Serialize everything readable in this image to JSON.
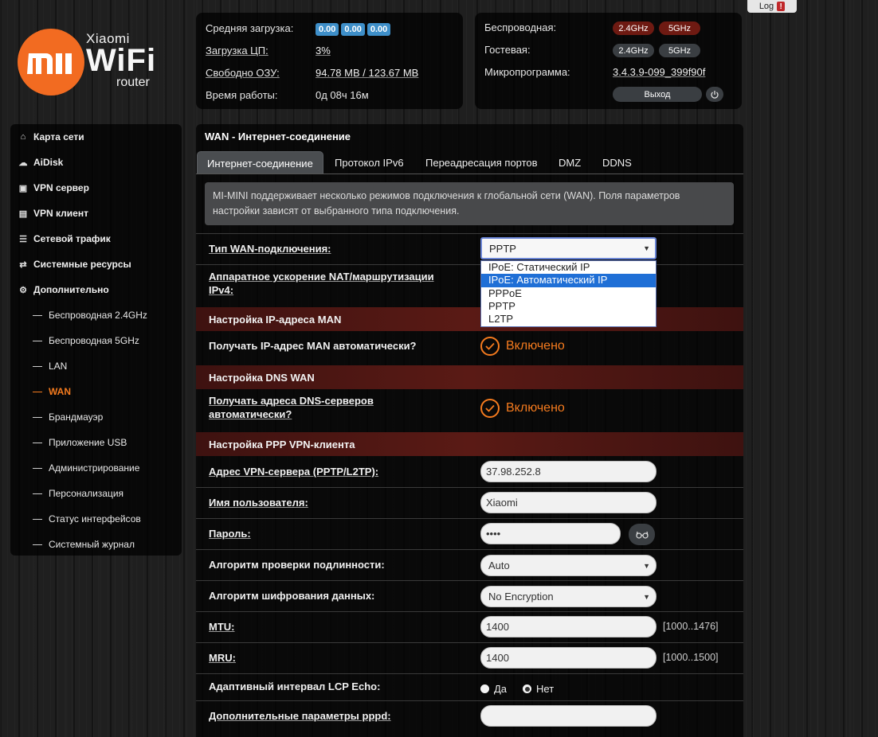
{
  "header": {
    "log_label": "Log",
    "log_badge": "!",
    "logo_xiaomi": "Xiaomi",
    "logo_wifi": "WiFi",
    "logo_router": "router",
    "logo_mi": "MI"
  },
  "status": {
    "avg_load_label": "Средняя загрузка:",
    "avg_load_values": [
      "0.00",
      "0.00",
      "0.00"
    ],
    "cpu_label": "Загрузка ЦП:",
    "cpu_value": "3%",
    "ram_label": "Свободно ОЗУ:",
    "ram_value": "94.78 MB / 123.67 MB",
    "uptime_label": "Время работы:",
    "uptime_value": "0д 08ч 16м",
    "wireless_label": "Беспроводная:",
    "guest_label": "Гостевая:",
    "band_24": "2.4GHz",
    "band_5": "5GHz",
    "firmware_label": "Микропрограмма:",
    "firmware_value": "3.4.3.9-099_399f90f",
    "exit_label": "Выход"
  },
  "sidebar": {
    "main_items": [
      {
        "label": "Карта сети",
        "icon": "home-icon"
      },
      {
        "label": "AiDisk",
        "icon": "cloud-icon"
      },
      {
        "label": "VPN сервер",
        "icon": "vpn-server-icon"
      },
      {
        "label": "VPN клиент",
        "icon": "vpn-client-icon"
      },
      {
        "label": "Сетевой трафик",
        "icon": "traffic-icon"
      },
      {
        "label": "Системные ресурсы",
        "icon": "shuffle-icon"
      },
      {
        "label": "Дополнительно",
        "icon": "gear-icon"
      }
    ],
    "sub_items": [
      "Беспроводная 2.4GHz",
      "Беспроводная 5GHz",
      "LAN",
      "WAN",
      "Брандмауэр",
      "Приложение USB",
      "Администрирование",
      "Персонализация",
      "Статус интерфейсов",
      "Системный журнал"
    ],
    "active_sub": "WAN"
  },
  "main": {
    "title": "WAN - Интернет-соединение",
    "tabs": [
      "Интернет-соединение",
      "Протокол IPv6",
      "Переадресация портов",
      "DMZ",
      "DDNS"
    ],
    "info": "MI-MINI поддерживает несколько режимов подключения к глобальной сети (WAN). Поля параметров настройки зависят от выбранного типа подключения.",
    "wan_type_label": "Тип WAN-подключения:",
    "wan_type_value": "PPTP",
    "wan_type_options": [
      "IPoE: Статический IP",
      "IPoE: Автоматический IP",
      "PPPoE",
      "PPTP",
      "L2TP"
    ],
    "wan_type_highlighted": "IPoE: Автоматический IP",
    "nat_label": "Аппаратное ускорение NAT/маршрутизации IPv4:",
    "section_man": "Настройка IP-адреса MAN",
    "man_auto_label": "Получать IP-адрес MAN автоматически?",
    "enabled_label": "Включено",
    "section_dns": "Настройка DNS WAN",
    "dns_auto_label": "Получать адреса DNS-серверов автоматически?",
    "section_ppp": "Настройка PPP VPN-клиента",
    "vpn_server_label": "Адрес VPN-сервера (PPTP/L2TP):",
    "vpn_server_value": "37.98.252.8",
    "username_label": "Имя пользователя:",
    "username_value": "Xiaomi",
    "password_label": "Пароль:",
    "password_value": "••••",
    "auth_label": "Алгоритм проверки подлинности:",
    "auth_value": "Auto",
    "enc_label": "Алгоритм шифрования данных:",
    "enc_value": "No Encryption",
    "mtu_label": "MTU:",
    "mtu_value": "1400",
    "mtu_range": "[1000..1476]",
    "mru_label": "MRU:",
    "mru_value": "1400",
    "mru_range": "[1000..1500]",
    "lcp_label": "Адаптивный интервал LCP Echo:",
    "lcp_yes": "Да",
    "lcp_no": "Нет",
    "lcp_selected": "Нет",
    "pppd_label": "Дополнительные параметры pppd:",
    "pppd_value": ""
  },
  "colors": {
    "accent": "#f57b1e",
    "logo": "#f26b21",
    "badge_blue": "#3e8fc9",
    "section_red": "#4a1512",
    "pill_red": "#6e1a12"
  }
}
